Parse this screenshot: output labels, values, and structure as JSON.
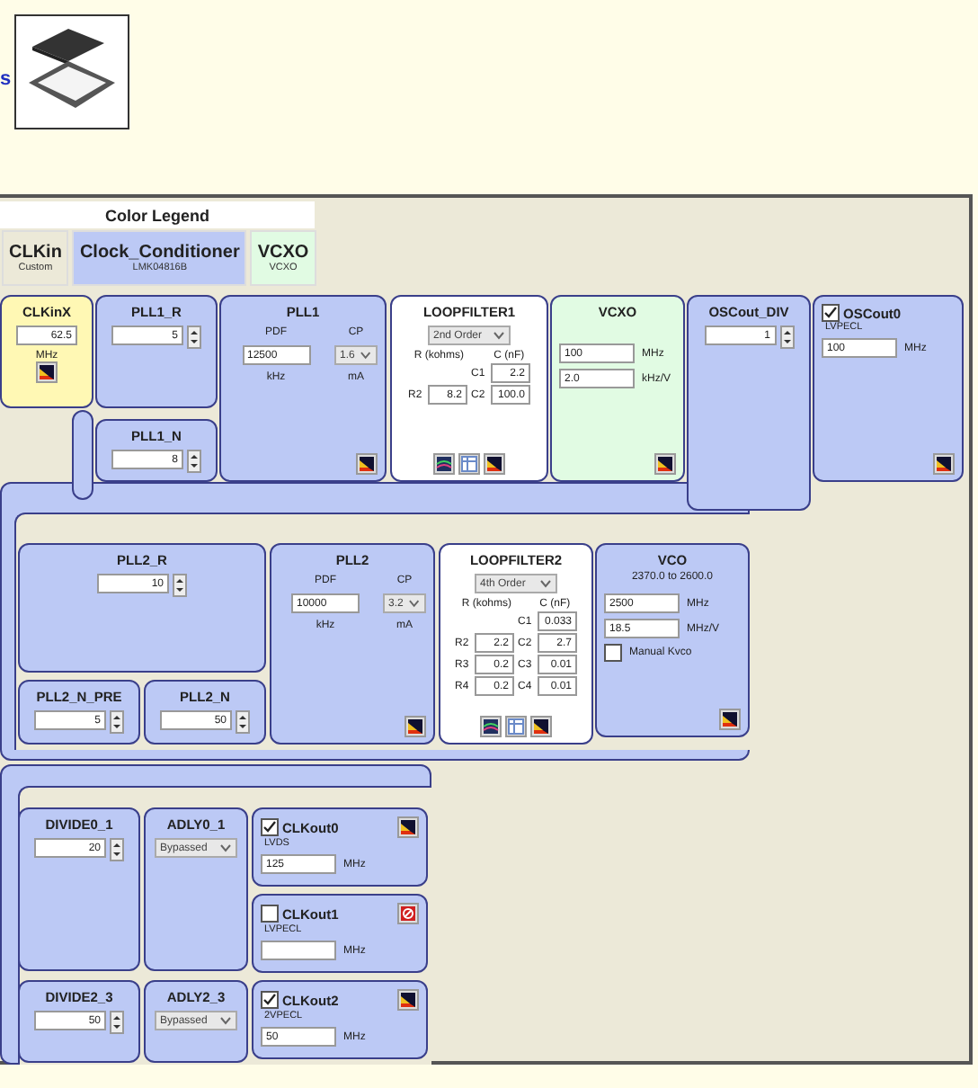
{
  "side_text": "s",
  "legend": {
    "title": "Color Legend",
    "items": [
      {
        "label": "CLKin",
        "sublabel": "Custom",
        "color": "#ece9d8"
      },
      {
        "label": "Clock_Conditioner",
        "sublabel": "LMK04816B",
        "color": "#bcc9f5"
      },
      {
        "label": "VCXO",
        "sublabel": "VCXO",
        "color": "#e1fbe3"
      }
    ]
  },
  "blocks": [
    {
      "kind": "clkin",
      "title": "CLKinX",
      "color": "#fff8b4",
      "value": "62.5",
      "unit": "MHz"
    },
    {
      "kind": "spinner",
      "title": "PLL1_R",
      "color": "#bcc9f5",
      "value": "5"
    },
    {
      "kind": "spinner",
      "title": "PLL1_N",
      "color": "#bcc9f5",
      "value": "8"
    },
    {
      "kind": "pll",
      "title": "PLL1",
      "color": "#bcc9f5",
      "pdf_label": "PDF",
      "cp_label": "CP",
      "pdf": "12500",
      "cp": "1.6",
      "pdf_unit": "kHz",
      "cp_unit": "mA"
    },
    {
      "kind": "loopfilter",
      "title": "LOOPFILTER1",
      "color": "#ffffff",
      "order": "2nd Order",
      "r_header": "R (kohms)",
      "c_header": "C (nF)",
      "rows": [
        {
          "r_label": "",
          "r": "",
          "c_label": "C1",
          "c": "2.2"
        },
        {
          "r_label": "R2",
          "r": "8.2",
          "c_label": "C2",
          "c": "100.0"
        }
      ]
    },
    {
      "kind": "vcxo",
      "title": "VCXO",
      "color": "#e1fbe3",
      "fields": [
        {
          "value": "100",
          "unit": "MHz"
        },
        {
          "value": "2.0",
          "unit": "kHz/V"
        }
      ]
    },
    {
      "kind": "spinner",
      "title": "OSCout_DIV",
      "color": "#bcc9f5",
      "value": "1"
    },
    {
      "kind": "output",
      "title": "OSCout0",
      "color": "#bcc9f5",
      "checked": true,
      "standard": "LVPECL",
      "value": "100",
      "unit": "MHz"
    },
    {
      "kind": "spinner",
      "title": "PLL2_R",
      "color": "#bcc9f5",
      "value": "10"
    },
    {
      "kind": "spinner",
      "title": "PLL2_N_PRE",
      "color": "#bcc9f5",
      "value": "5"
    },
    {
      "kind": "spinner",
      "title": "PLL2_N",
      "color": "#bcc9f5",
      "value": "50"
    },
    {
      "kind": "pll",
      "title": "PLL2",
      "color": "#bcc9f5",
      "pdf_label": "PDF",
      "cp_label": "CP",
      "pdf": "10000",
      "cp": "3.2",
      "pdf_unit": "kHz",
      "cp_unit": "mA"
    },
    {
      "kind": "loopfilter",
      "title": "LOOPFILTER2",
      "color": "#ffffff",
      "order": "4th Order",
      "r_header": "R (kohms)",
      "c_header": "C (nF)",
      "rows": [
        {
          "r_label": "",
          "r": "",
          "c_label": "C1",
          "c": "0.033"
        },
        {
          "r_label": "R2",
          "r": "2.2",
          "c_label": "C2",
          "c": "2.7"
        },
        {
          "r_label": "R3",
          "r": "0.2",
          "c_label": "C3",
          "c": "0.01"
        },
        {
          "r_label": "R4",
          "r": "0.2",
          "c_label": "C4",
          "c": "0.01"
        }
      ]
    },
    {
      "kind": "vco",
      "title": "VCO",
      "color": "#bcc9f5",
      "range": "2370.0 to 2600.0",
      "fields": [
        {
          "value": "2500",
          "unit": "MHz"
        },
        {
          "value": "18.5",
          "unit": "MHz/V"
        }
      ],
      "manual": {
        "label": "Manual Kvco",
        "checked": false
      }
    },
    {
      "kind": "spinner",
      "title": "DIVIDE0_1",
      "color": "#bcc9f5",
      "value": "20"
    },
    {
      "kind": "select",
      "title": "ADLY0_1",
      "color": "#bcc9f5",
      "value": "Bypassed"
    },
    {
      "kind": "output",
      "title": "CLKout0",
      "color": "#bcc9f5",
      "checked": true,
      "standard": "LVDS",
      "value": "125",
      "unit": "MHz"
    },
    {
      "kind": "output",
      "title": "CLKout1",
      "color": "#bcc9f5",
      "checked": false,
      "standard": "LVPECL",
      "unit": "MHz"
    },
    {
      "kind": "spinner",
      "title": "DIVIDE2_3",
      "color": "#bcc9f5",
      "value": "50"
    },
    {
      "kind": "select",
      "title": "ADLY2_3",
      "color": "#bcc9f5",
      "value": "Bypassed"
    },
    {
      "kind": "output",
      "title": "CLKout2",
      "color": "#bcc9f5",
      "checked": true,
      "standard": "2VPECL",
      "value": "50",
      "unit": "MHz"
    }
  ]
}
